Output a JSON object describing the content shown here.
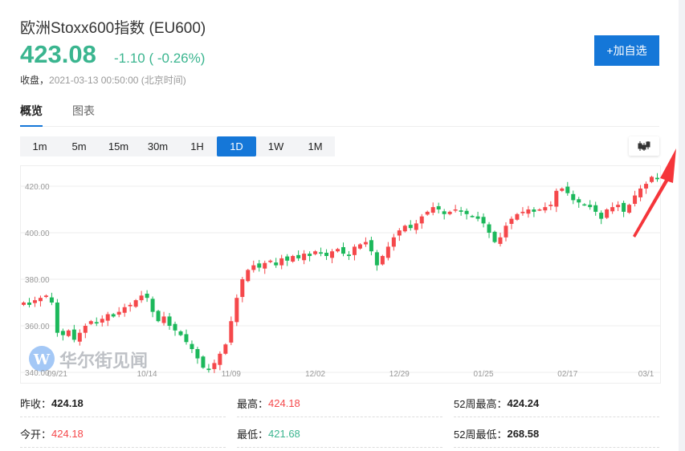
{
  "header": {
    "title": "欧洲Stoxx600指数 (EU600)",
    "price": "423.08",
    "change": "-1.10 ( -0.26%)",
    "status_label": "收盘，",
    "timestamp": "2021-03-13 00:50:00",
    "timezone": "(北京时间)",
    "add_button": "+加自选"
  },
  "tabs": [
    {
      "label": "概览"
    },
    {
      "label": "图表"
    }
  ],
  "periods": [
    {
      "label": "1m"
    },
    {
      "label": "5m"
    },
    {
      "label": "15m"
    },
    {
      "label": "30m"
    },
    {
      "label": "1H"
    },
    {
      "label": "1D"
    },
    {
      "label": "1W"
    },
    {
      "label": "1M"
    }
  ],
  "watermark": "华尔街见闻",
  "colors": {
    "up": "#f5484b",
    "down": "#1cb85b",
    "accent": "#1577d8"
  },
  "chart_data": {
    "type": "candlestick",
    "ylim": [
      340,
      426
    ],
    "y_ticks": [
      "420.00",
      "400.00",
      "380.00",
      "360.00",
      "340.00"
    ],
    "y_tick_values": [
      420,
      400,
      380,
      360,
      340
    ],
    "x_ticks": [
      "09/21",
      "10/14",
      "11/09",
      "12/02",
      "12/29",
      "01/25",
      "02/17",
      "03/1"
    ],
    "x_tick_index": [
      6,
      22,
      37,
      52,
      67,
      82,
      97,
      111
    ],
    "closes": [
      370,
      369,
      371,
      372,
      373,
      370,
      357,
      356,
      358,
      354,
      357,
      360,
      362,
      361,
      363,
      365,
      364,
      366,
      368,
      369,
      371,
      373,
      372,
      366,
      362,
      364,
      360,
      358,
      356,
      353,
      350,
      346,
      342,
      341,
      344,
      348,
      352,
      362,
      372,
      380,
      384,
      386,
      385,
      387,
      388,
      386,
      389,
      388,
      390,
      389,
      391,
      390,
      392,
      391,
      390,
      392,
      393,
      391,
      390,
      394,
      395,
      396,
      392,
      386,
      390,
      394,
      398,
      401,
      403,
      402,
      404,
      407,
      409,
      411,
      410,
      408,
      409,
      410,
      409,
      408,
      407,
      406,
      404,
      400,
      396,
      398,
      403,
      406,
      408,
      409,
      410,
      409,
      410,
      411,
      412,
      418,
      419,
      417,
      414,
      413,
      412,
      411,
      409,
      406,
      410,
      411,
      412,
      409,
      412,
      416,
      419,
      421,
      424,
      423
    ]
  },
  "stats": [
    {
      "label": "昨收：",
      "value": "424.18",
      "tone": "neutral"
    },
    {
      "label": "最高：",
      "value": "424.18",
      "tone": "up"
    },
    {
      "label": "52周最高：",
      "value": "424.24",
      "tone": "neutral"
    },
    {
      "label": "今开：",
      "value": "424.18",
      "tone": "up"
    },
    {
      "label": "最低：",
      "value": "421.68",
      "tone": "down"
    },
    {
      "label": "52周最低：",
      "value": "268.58",
      "tone": "neutral"
    }
  ]
}
